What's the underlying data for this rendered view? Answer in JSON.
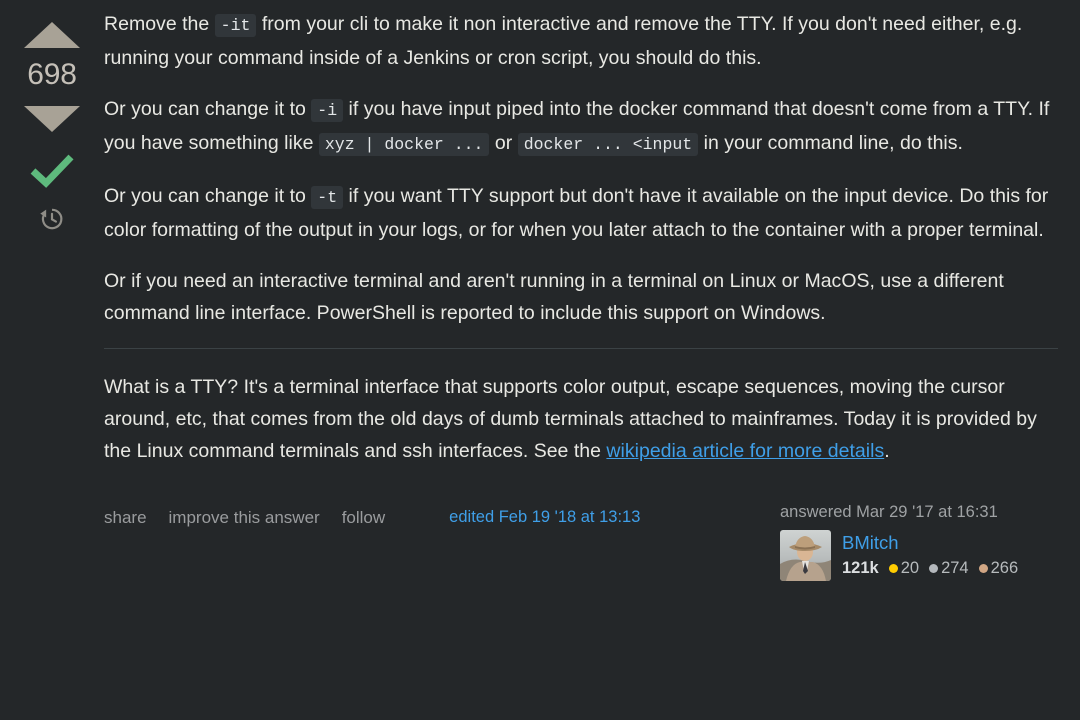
{
  "theme": {
    "background": "#242729",
    "text": "#e8e8e3",
    "link": "#3f9fe8",
    "muted": "#9a9c9e",
    "code_bg": "#31363a",
    "vote_arrow": "#a8a296",
    "accepted_green": "#5eba7d",
    "gold": "#ffcc01",
    "silver": "#b4b8bc",
    "bronze": "#d1a684"
  },
  "vote": {
    "score": "698",
    "up_label": "up-vote",
    "down_label": "down-vote",
    "accepted_label": "accepted-answer",
    "history_label": "revision-history"
  },
  "body": {
    "paragraphs": [
      {
        "parts": [
          {
            "type": "text",
            "value": "Remove the "
          },
          {
            "type": "code",
            "value": "-it"
          },
          {
            "type": "text",
            "value": " from your cli to make it non interactive and remove the TTY. If you don't need either, e.g. running your command inside of a Jenkins or cron script, you should do this."
          }
        ]
      },
      {
        "parts": [
          {
            "type": "text",
            "value": "Or you can change it to "
          },
          {
            "type": "code",
            "value": "-i"
          },
          {
            "type": "text",
            "value": " if you have input piped into the docker command that doesn't come from a TTY. If you have something like "
          },
          {
            "type": "code",
            "value": "xyz | docker ..."
          },
          {
            "type": "text",
            "value": " or "
          },
          {
            "type": "code",
            "value": "docker ... <input"
          },
          {
            "type": "text",
            "value": " in your command line, do this."
          }
        ]
      },
      {
        "parts": [
          {
            "type": "text",
            "value": "Or you can change it to "
          },
          {
            "type": "code",
            "value": "-t"
          },
          {
            "type": "text",
            "value": " if you want TTY support but don't have it available on the input device. Do this for color formatting of the output in your logs, or for when you later attach to the container with a proper terminal."
          }
        ]
      },
      {
        "parts": [
          {
            "type": "text",
            "value": "Or if you need an interactive terminal and aren't running in a terminal on Linux or MacOS, use a different command line interface. PowerShell is reported to include this support on Windows."
          }
        ]
      }
    ],
    "after_divider": [
      {
        "parts": [
          {
            "type": "text",
            "value": "What is a TTY? It's a terminal interface that supports color output, escape sequences, moving the cursor around, etc, that comes from the old days of dumb terminals attached to mainframes. Today it is provided by the Linux command terminals and ssh interfaces. See the "
          },
          {
            "type": "link",
            "value": "wikipedia article for more details"
          },
          {
            "type": "text",
            "value": "."
          }
        ]
      }
    ]
  },
  "footer": {
    "menu": [
      {
        "label": "share"
      },
      {
        "label": "improve this answer"
      },
      {
        "label": "follow"
      }
    ],
    "edited": "edited Feb 19 '18 at 13:13",
    "user": {
      "action_time": "answered Mar 29 '17 at 16:31",
      "name": "BMitch",
      "reputation": "121k",
      "badges": [
        {
          "tier": "gold",
          "count": "20"
        },
        {
          "tier": "silver",
          "count": "274"
        },
        {
          "tier": "bronze",
          "count": "266"
        }
      ],
      "avatar_alt": "avatar-photo-cowboy-hat"
    }
  }
}
